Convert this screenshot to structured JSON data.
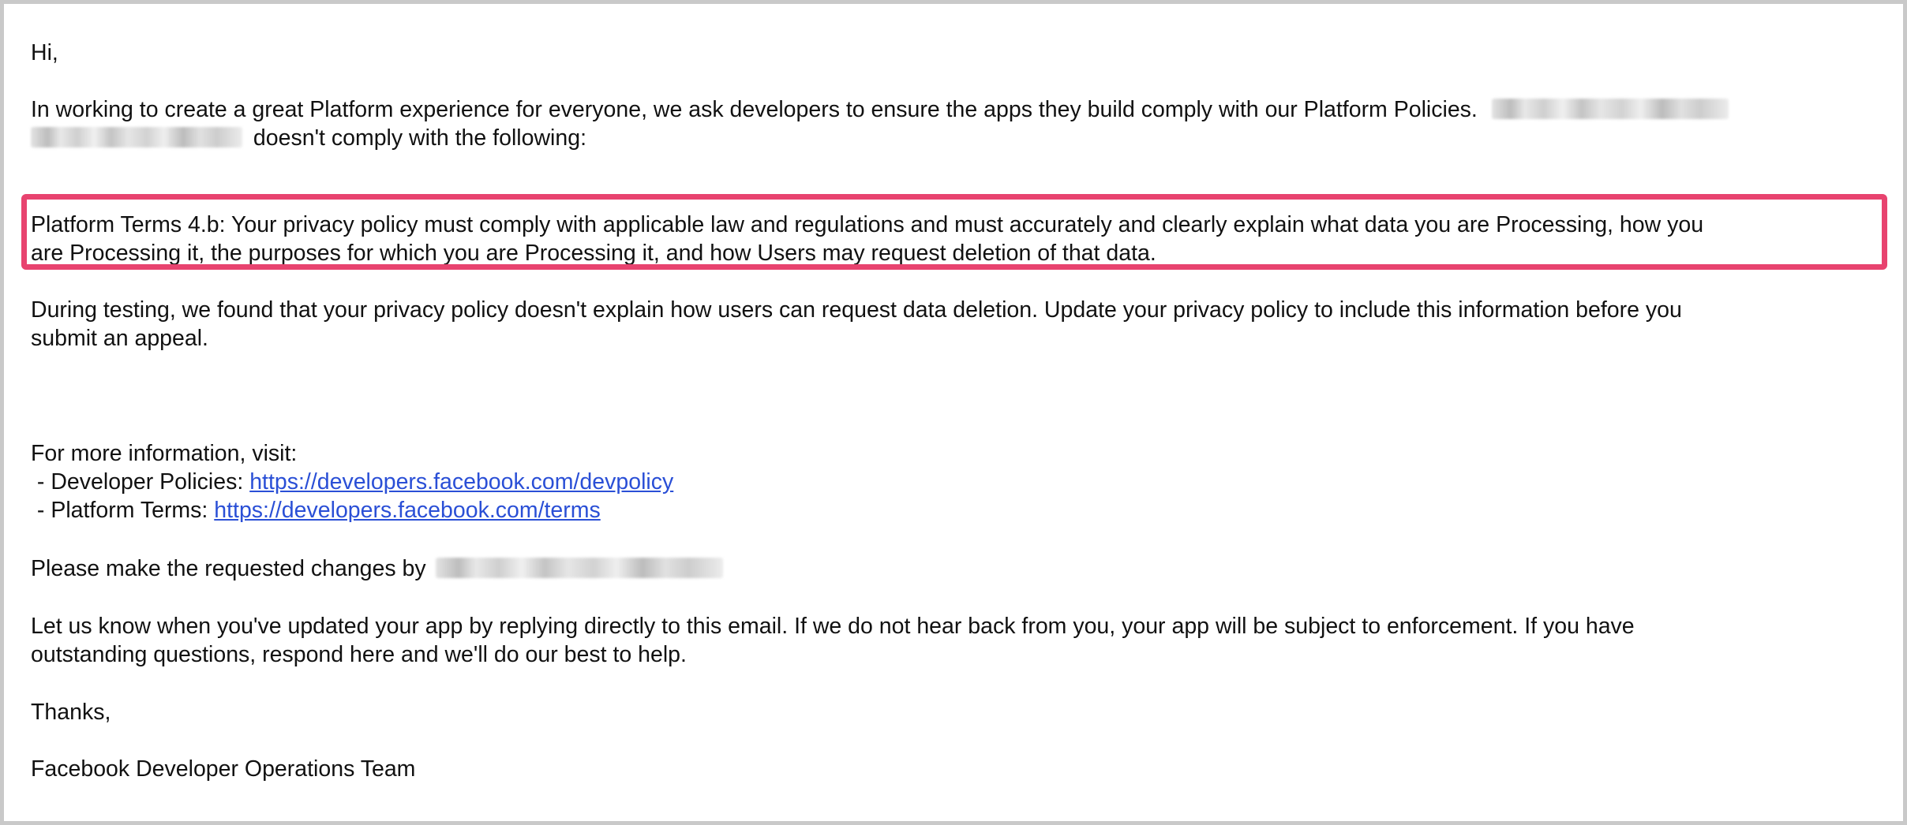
{
  "email": {
    "greeting": "Hi,",
    "intro_line1": "In working to create a great Platform experience for everyone, we ask developers to ensure the apps they build comply with our Platform Policies.",
    "intro_line2": "doesn't comply with the following:",
    "highlight_line1": "Platform Terms 4.b: Your privacy policy must comply with applicable law and regulations and must accurately and clearly explain what data you are Processing, how you",
    "highlight_line2": "are Processing it, the purposes for which you are Processing it, and how Users may request deletion of that data.",
    "testing_line1": "During testing, we found that your privacy policy doesn't explain how users can request data deletion. Update your privacy policy to include this information before you",
    "testing_line2": "submit an appeal.",
    "info_heading": "For more information, visit:",
    "dev_policies_label": " - Developer Policies: ",
    "dev_policies_url": "https://developers.facebook.com/devpolicy",
    "platform_terms_label": " - Platform Terms: ",
    "platform_terms_url": "https://developers.facebook.com/terms",
    "changes_by": "Please make the requested changes by",
    "let_us_know_line1": "Let us know when you've updated your app by replying directly to this email. If we do not hear back from you, your app will be subject to enforcement. If you have",
    "let_us_know_line2": "outstanding questions, respond here and we'll do our best to help.",
    "thanks": "Thanks,",
    "signature": "Facebook Developer Operations Team"
  },
  "colors": {
    "highlight_border": "#e8436f",
    "link": "#2a4fd6",
    "frame_border": "#c9c9c9"
  }
}
